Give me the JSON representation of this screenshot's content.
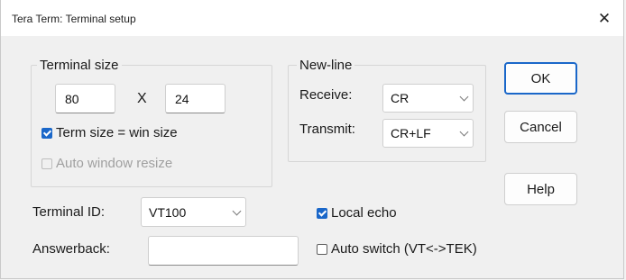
{
  "window": {
    "title": "Tera Term: Terminal setup",
    "close_glyph": "✕"
  },
  "terminal_size": {
    "legend": "Terminal size",
    "columns": "80",
    "x_label": "X",
    "rows": "24",
    "term_size_win_size": {
      "label": "Term size = win size",
      "checked": true
    },
    "auto_window_resize": {
      "label": "Auto window resize",
      "checked": false,
      "disabled": true
    }
  },
  "new_line": {
    "legend": "New-line",
    "receive_label": "Receive:",
    "receive_value": "CR",
    "transmit_label": "Transmit:",
    "transmit_value": "CR+LF"
  },
  "terminal_id": {
    "label": "Terminal ID:",
    "value": "VT100"
  },
  "answerback": {
    "label": "Answerback:",
    "value": ""
  },
  "local_echo": {
    "label": "Local echo",
    "checked": true
  },
  "auto_switch": {
    "label": "Auto switch (VT<->TEK)",
    "checked": false
  },
  "buttons": {
    "ok": "OK",
    "cancel": "Cancel",
    "help": "Help"
  },
  "colors": {
    "accent": "#1a67c9",
    "dialog_bg": "#f0f0f0"
  }
}
